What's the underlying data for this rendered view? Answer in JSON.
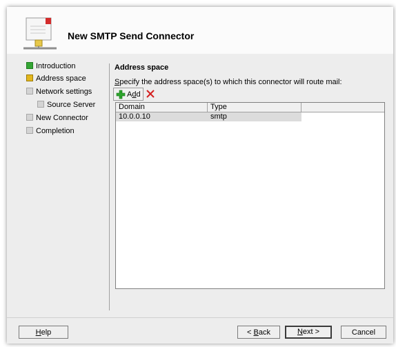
{
  "window": {
    "title": "New SMTP Send Connector"
  },
  "nav": {
    "items": [
      {
        "label": "Introduction",
        "state": "done"
      },
      {
        "label": "Address space",
        "state": "current"
      },
      {
        "label": "Network settings",
        "state": "pending"
      },
      {
        "label": "Source Server",
        "state": "pending"
      },
      {
        "label": "New Connector",
        "state": "pending"
      },
      {
        "label": "Completion",
        "state": "pending"
      }
    ]
  },
  "page": {
    "title": "Address space",
    "instruction_underlined": "S",
    "instruction_rest": "pecify the address space(s) to which this connector will route mail:"
  },
  "toolbar": {
    "add_label_prefix": "A",
    "add_label_underlined": "d",
    "add_label_suffix": "d",
    "add_icon": "green-plus-icon",
    "delete_icon": "red-x-icon"
  },
  "list": {
    "columns": [
      "Domain",
      "Type"
    ],
    "rows": [
      {
        "domain": "10.0.0.10",
        "type": "smtp"
      }
    ]
  },
  "buttons": {
    "help_underlined": "H",
    "help_rest": "elp",
    "back_prefix": "< ",
    "back_underlined": "B",
    "back_rest": "ack",
    "next_underlined": "N",
    "next_rest": "ext >",
    "cancel": "Cancel"
  },
  "colors": {
    "done": "#34a534",
    "current": "#e2b61d",
    "pending": "#d4d4d4",
    "delete": "#d42020",
    "add": "#2ea52e"
  }
}
